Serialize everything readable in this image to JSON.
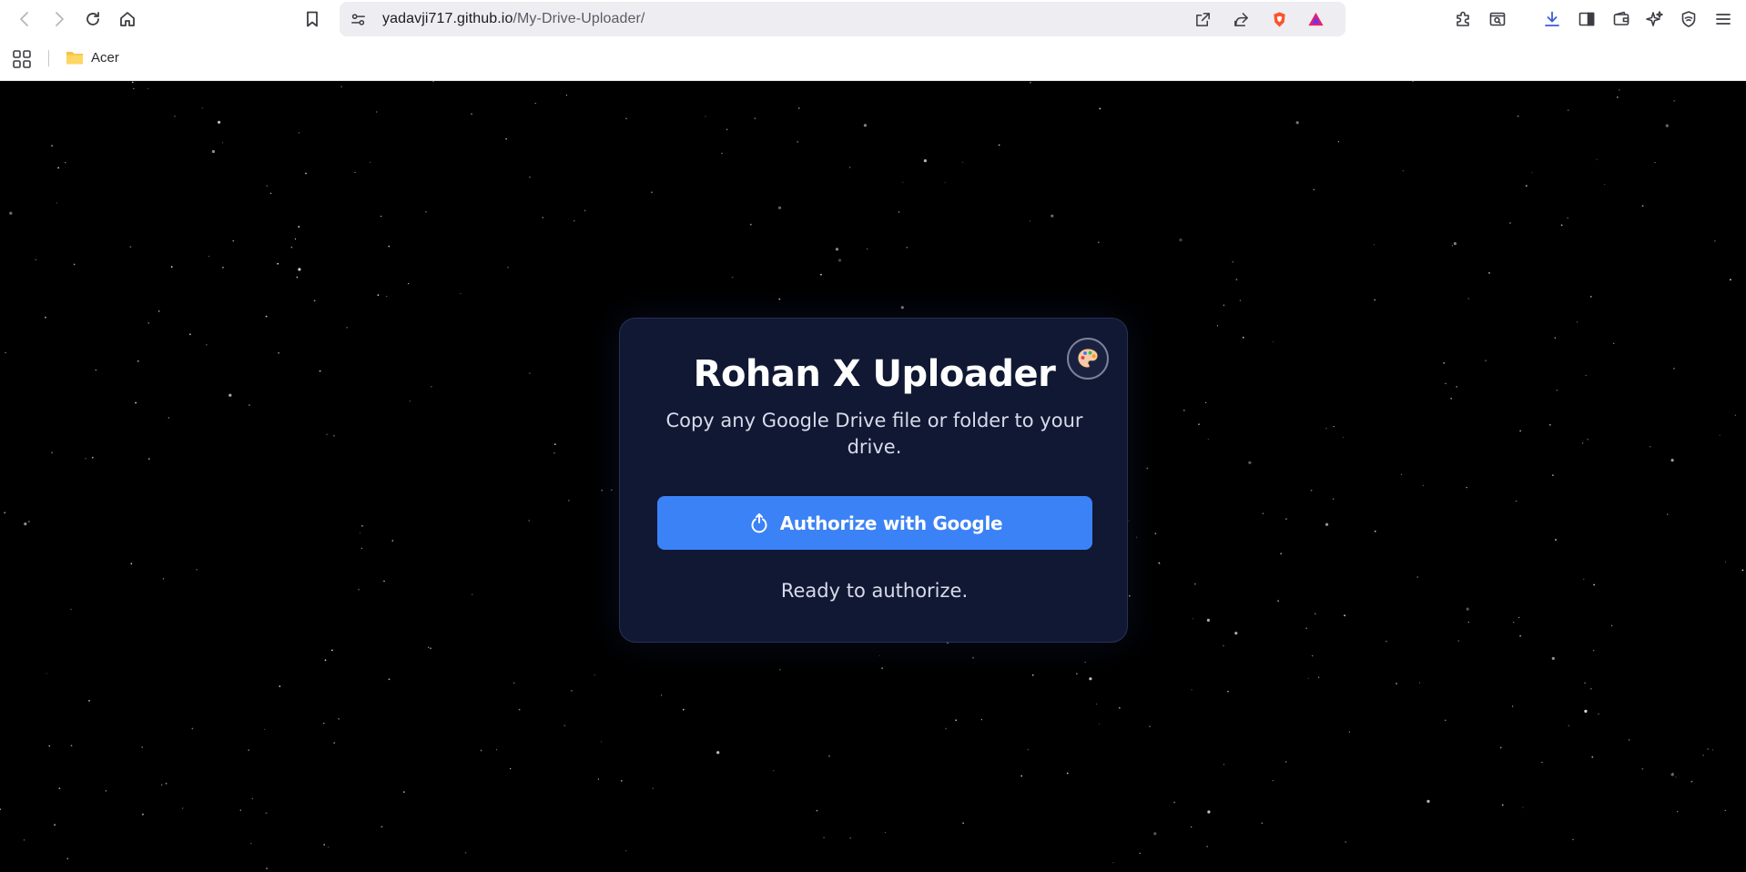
{
  "browser": {
    "url_host": "yadavji717.github.io",
    "url_path": "/My-Drive-Uploader/",
    "bookmarks": [
      {
        "label": "Acer"
      }
    ],
    "toolbar_icons": [
      "back-icon",
      "forward-icon",
      "reload-icon",
      "home-icon",
      "bookmark-icon",
      "site-settings-icon",
      "open-in-app-icon",
      "share-icon",
      "brave-shields-icon",
      "brave-rewards-icon",
      "extensions-icon",
      "tab-search-icon",
      "downloads-icon",
      "sidebar-icon",
      "wallet-icon",
      "leo-ai-icon",
      "vpn-icon",
      "menu-icon"
    ]
  },
  "card": {
    "title": "Rohan X Uploader",
    "subtitle": "Copy any Google Drive file or folder to your drive.",
    "auth_button_label": "Authorize with Google",
    "status_text": "Ready to authorize.",
    "theme_button_icon": "palette-icon",
    "auth_button_icon": "sign-in-icon"
  },
  "colors": {
    "page_background": "#000000",
    "card_background": "#111833",
    "accent": "#3b82f6",
    "title_text": "#ffffff",
    "body_text": "#d7dbea"
  }
}
